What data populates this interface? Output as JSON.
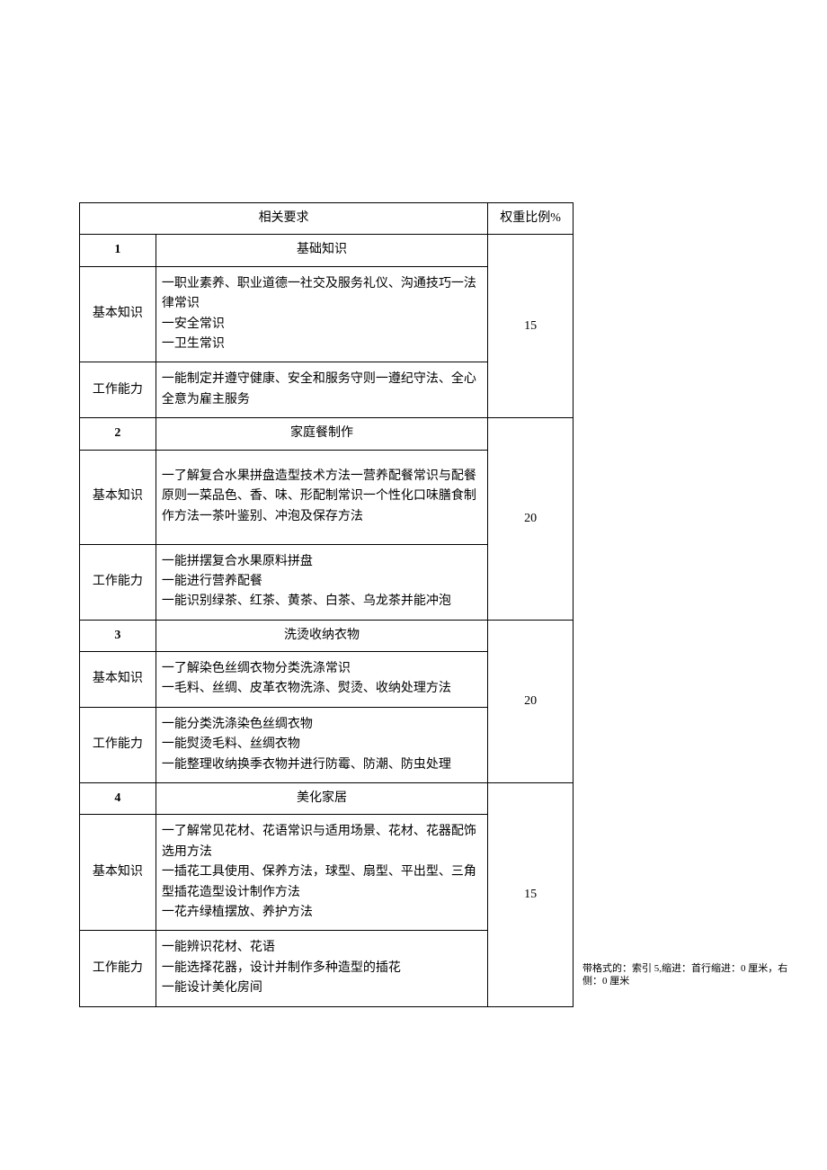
{
  "headers": {
    "requirements": "相关要求",
    "weight": "权重比例%"
  },
  "sections": [
    {
      "num": "1",
      "title": "基础知识",
      "weight": "15",
      "rows": [
        {
          "label": "基本知识",
          "content": "一职业素养、职业道德一社交及服务礼仪、沟通技巧一法律常识\n一安全常识\n一卫生常识"
        },
        {
          "label": "工作能力",
          "content": "一能制定并遵守健康、安全和服务守则一遵纪守法、全心全意为雇主服务"
        }
      ]
    },
    {
      "num": "2",
      "title": "家庭餐制作",
      "weight": "20",
      "rows": [
        {
          "label": "基本知识",
          "content": "一了解复合水果拼盘造型技术方法一营养配餐常识与配餐原则一菜品色、香、味、形配制常识一个性化口味膳食制作方法一茶叶鉴别、冲泡及保存方法"
        },
        {
          "label": "工作能力",
          "content": "一能拼摆复合水果原料拼盘\n一能进行营养配餐\n一能识别绿茶、红茶、黄茶、白茶、乌龙茶并能冲泡"
        }
      ]
    },
    {
      "num": "3",
      "title": "洗烫收纳衣物",
      "weight": "20",
      "rows": [
        {
          "label": "基本知识",
          "content": "一了解染色丝绸衣物分类洗涤常识\n一毛料、丝绸、皮革衣物洗涤、熨烫、收纳处理方法"
        },
        {
          "label": "工作能力",
          "content": "一能分类洗涤染色丝绸衣物\n一能熨烫毛料、丝绸衣物\n一能整理收纳换季衣物并进行防霉、防潮、防虫处理"
        }
      ]
    },
    {
      "num": "4",
      "title": "美化家居",
      "weight": "15",
      "rows": [
        {
          "label": "基本知识",
          "content": "一了解常见花材、花语常识与适用场景、花材、花器配饰选用方法\n一插花工具使用、保养方法，球型、扇型、平出型、三角型插花造型设计制作方法\n一花卉绿植摆放、养护方法"
        },
        {
          "label": "工作能力",
          "content": "一能辨识花材、花语\n一能选择花器，设计并制作多种造型的插花\n一能设计美化房间"
        }
      ]
    }
  ],
  "annotation": "带格式的：索引 5,缩进：首行缩进：0 厘米，右侧：0 厘米"
}
